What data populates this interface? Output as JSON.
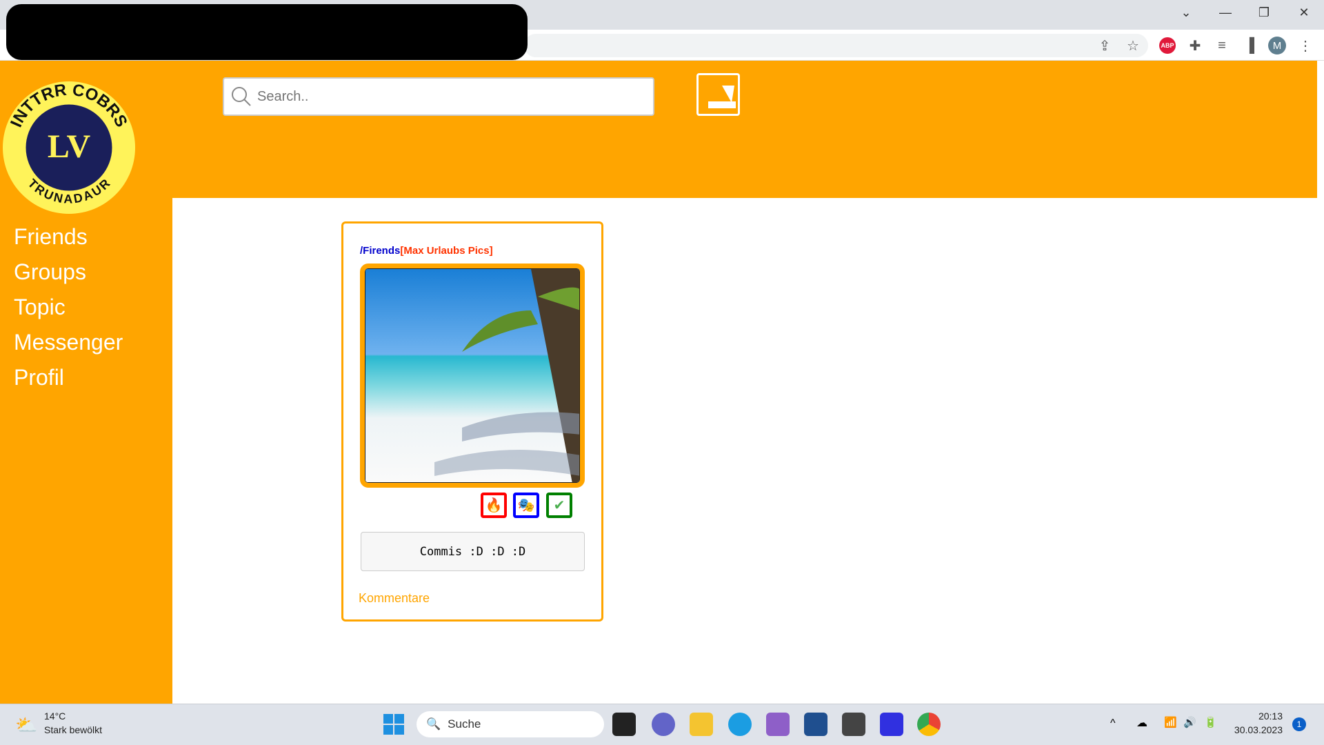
{
  "browser": {
    "window_controls": [
      "⌄",
      "—",
      "❐",
      "✕"
    ],
    "avatar_letter": "M",
    "abp_label": "ABP"
  },
  "header": {
    "search_placeholder": "Search.."
  },
  "logo": {
    "text_top": "INTTRR COBRS",
    "text_bottom": "TRUNADAUR",
    "monogram": "LV"
  },
  "sidebar": {
    "items": [
      {
        "label": "Friends"
      },
      {
        "label": "Groups"
      },
      {
        "label": "Topic"
      },
      {
        "label": "Messenger"
      },
      {
        "label": "Profil"
      }
    ]
  },
  "post": {
    "breadcrumb_path": "/Firends",
    "breadcrumb_title": "[Max Urlaubs Pics]",
    "path_color": "#0000cc",
    "title_color": "#ff3300",
    "reactions": [
      {
        "icon": "fire-icon",
        "color": "#ff0000"
      },
      {
        "icon": "masks-icon",
        "color": "#0000ff"
      },
      {
        "icon": "check-icon",
        "color": "#008000"
      }
    ],
    "comment": "Commis :D :D :D",
    "comments_link": "Kommentare"
  },
  "taskbar": {
    "weather_temp": "14°C",
    "weather_desc": "Stark bewölkt",
    "search_label": "Suche",
    "time": "20:13",
    "date": "30.03.2023",
    "notification_count": "1"
  },
  "colors": {
    "accent": "#ffa500"
  }
}
